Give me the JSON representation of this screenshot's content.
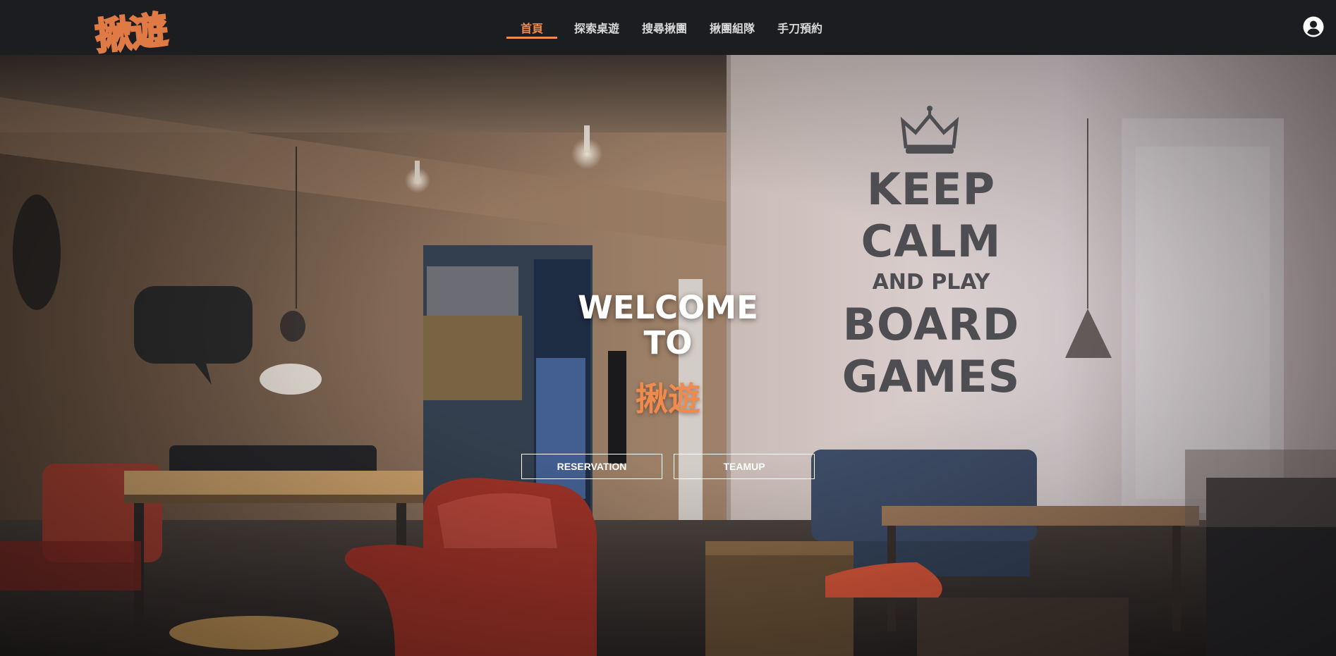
{
  "logo": {
    "text": "揪遊"
  },
  "nav": {
    "items": [
      {
        "label": "首頁",
        "active": true
      },
      {
        "label": "探索桌遊",
        "active": false
      },
      {
        "label": "搜尋揪團",
        "active": false
      },
      {
        "label": "揪團組隊",
        "active": false
      },
      {
        "label": "手刀預約",
        "active": false
      }
    ]
  },
  "hero": {
    "welcome_line1": "WELCOME",
    "welcome_line2": "TO",
    "brand": "揪遊",
    "poster": {
      "line1": "KEEP",
      "line2": "CALM",
      "line3": "AND PLAY",
      "line4": "BOARD",
      "line5": "GAMES"
    },
    "buttons": {
      "reservation": "RESERVATION",
      "teamup": "TEAMUP"
    }
  },
  "icons": {
    "account": "account-circle-icon"
  },
  "colors": {
    "accent": "#ef8b4f",
    "navbar": "#1c1d20",
    "text_light": "#ffffff"
  }
}
